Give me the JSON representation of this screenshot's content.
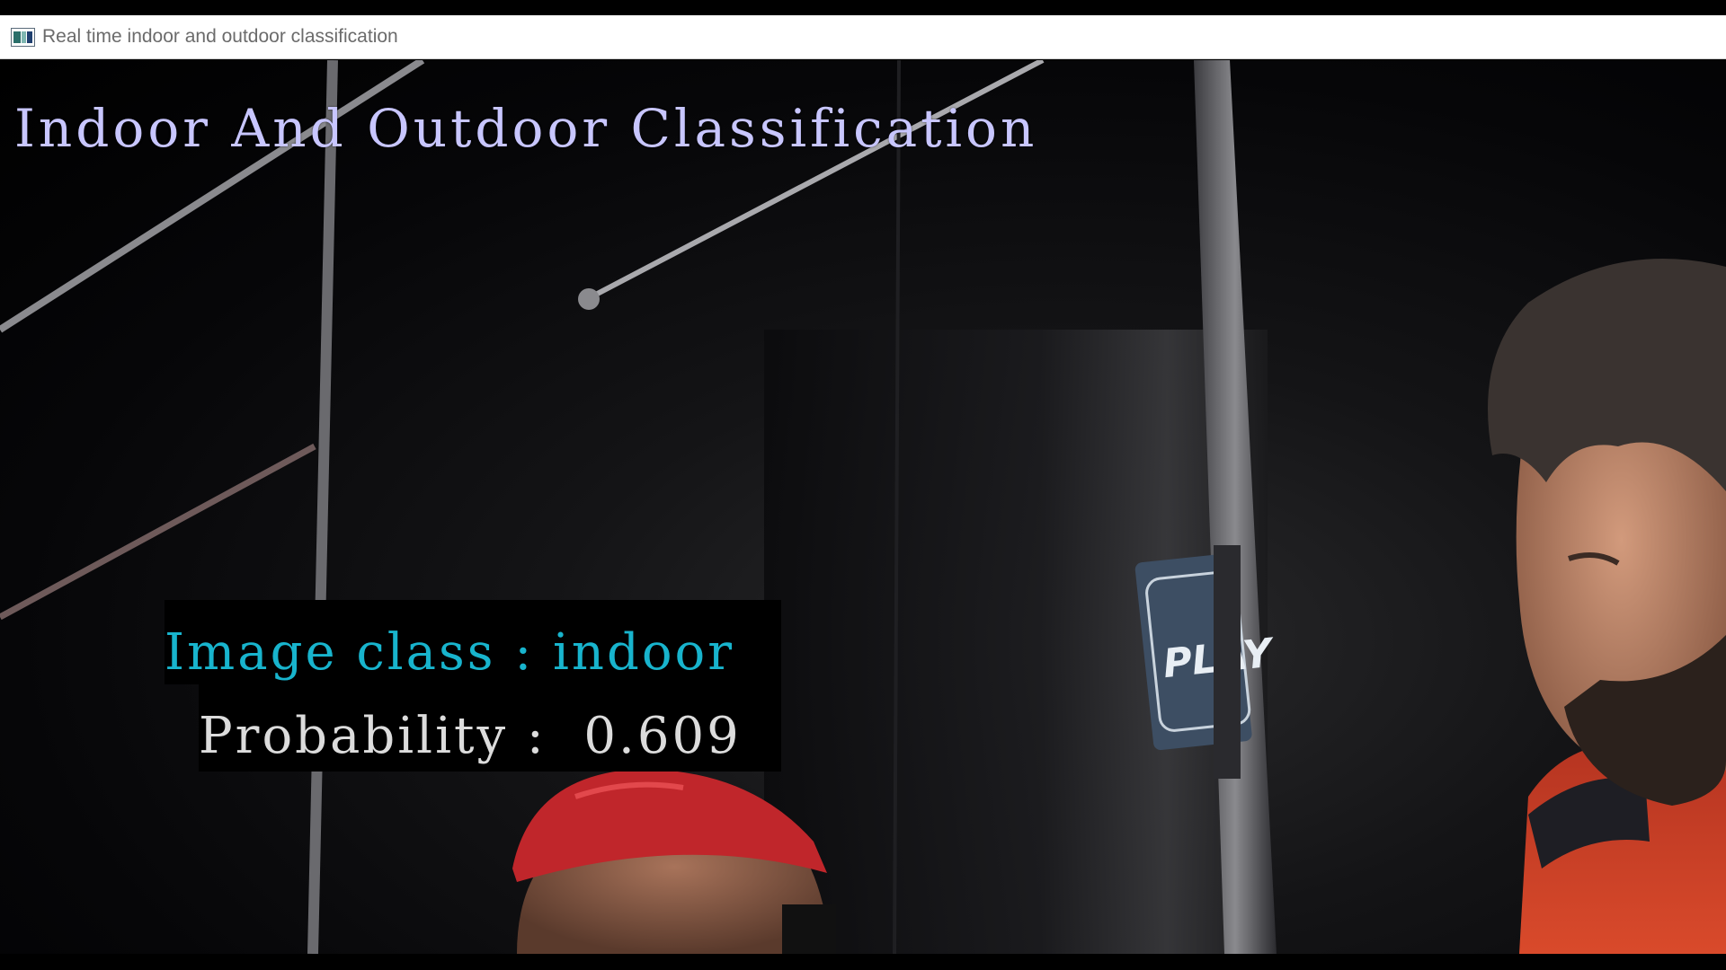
{
  "window": {
    "title": "Real time indoor and outdoor classification",
    "icon": "app-window-icon"
  },
  "overlay": {
    "heading": "Indoor And Outdoor Classification",
    "class_line": "Image class : indoor",
    "probability_line": "Probability :  0.609",
    "colors": {
      "heading": "#c8c6ff",
      "class": "#18b4cd",
      "probability": "#dcdcdc"
    }
  },
  "scene": {
    "sign_text": "PLAY"
  }
}
